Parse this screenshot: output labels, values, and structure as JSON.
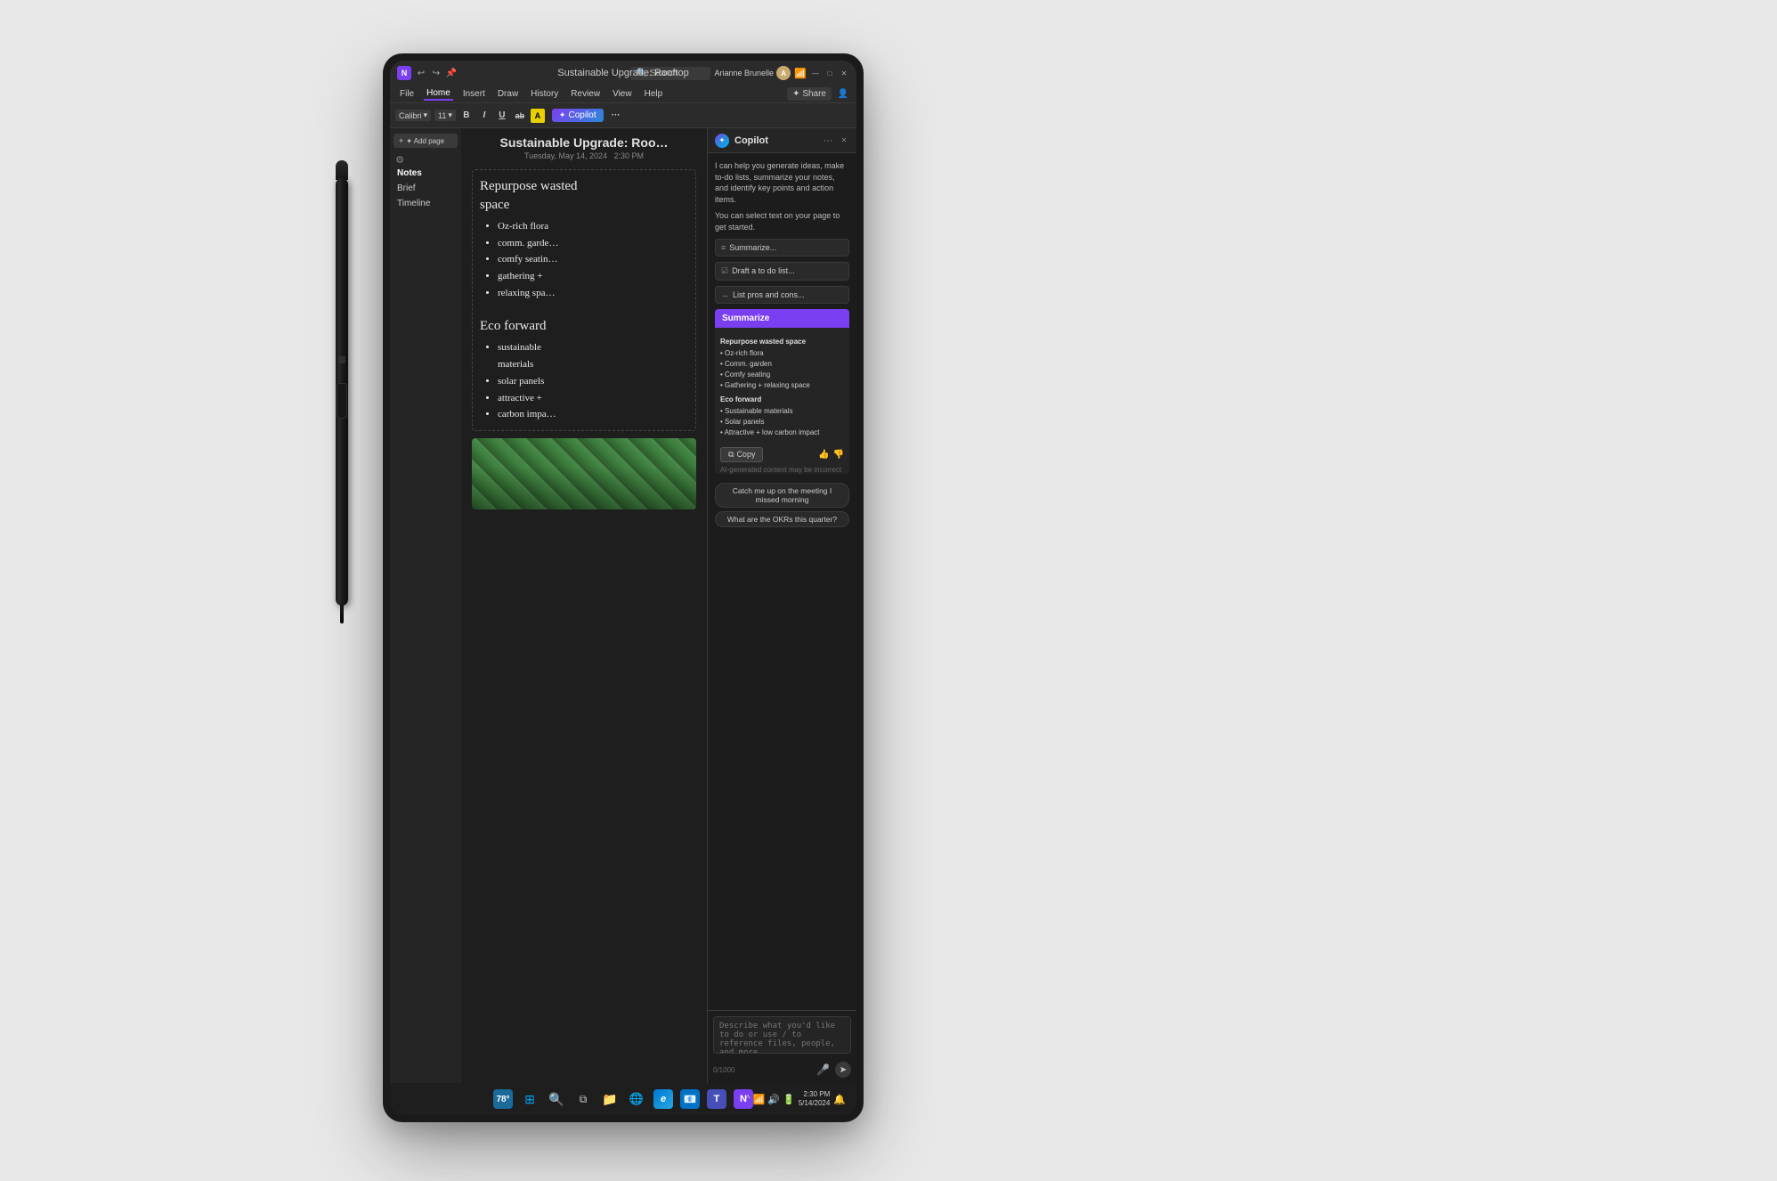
{
  "page": {
    "background_color": "#e8e8e8"
  },
  "titlebar": {
    "app_icon_label": "N",
    "undo_icon": "↩",
    "redo_icon": "↪",
    "pin_icon": "📌",
    "title": "Sustainable Upgrade: Rooftop",
    "search_placeholder": "Search",
    "user_name": "Arianne Brunelle",
    "wifi_icon": "📶",
    "minimize_icon": "—",
    "maximize_icon": "□",
    "close_icon": "✕"
  },
  "menubar": {
    "items": [
      {
        "label": "File",
        "active": false
      },
      {
        "label": "Home",
        "active": true
      },
      {
        "label": "Insert",
        "active": false
      },
      {
        "label": "Draw",
        "active": false
      },
      {
        "label": "History",
        "active": false
      },
      {
        "label": "Review",
        "active": false
      },
      {
        "label": "View",
        "active": false
      },
      {
        "label": "Help",
        "active": false
      }
    ],
    "share_label": "✦ Share",
    "profile_icon": "👤"
  },
  "ribbon": {
    "font_name": "Calibri",
    "font_size": "11",
    "bold": "B",
    "italic": "I",
    "underline": "U",
    "strikethrough": "ab",
    "highlight": "A",
    "copilot_label": "Copilot"
  },
  "sidebar": {
    "add_page_label": "✦ Add page",
    "sections": [
      {
        "label": "Notes",
        "active": true
      },
      {
        "label": "Brief"
      },
      {
        "label": "Timeline"
      }
    ]
  },
  "note": {
    "title": "Sustainable Upgrade: Roo…",
    "date": "Tuesday, May 14, 2024",
    "time": "2:30 PM",
    "content": {
      "heading1": "Repurpose wasted space",
      "bullets1": [
        "Oz-rich flora",
        "comm. garde…",
        "comfy seatin…",
        "gathering +",
        "relaxing spa…"
      ],
      "heading2": "Eco forward",
      "bullets2": [
        "sustainable materials",
        "solar panels",
        "attractive +",
        "carbon impa…"
      ]
    }
  },
  "copilot": {
    "title": "Copilot",
    "more_icon": "···",
    "close_icon": "✕",
    "intro_text": "I can help you generate ideas, make to-do lists, summarize your notes, and identify key points and action items.",
    "sub_text": "You can select text on your page to get started.",
    "suggestions": [
      {
        "icon": "≡",
        "label": "Summarize..."
      },
      {
        "icon": "☑",
        "label": "Draft a to do list..."
      },
      {
        "icon": "↔",
        "label": "List pros and cons..."
      }
    ],
    "summarize_button_label": "Summarize",
    "summary": {
      "heading1": "Repurpose wasted space",
      "bullets1": [
        "Oz-rich flora",
        "Comm. garden",
        "Comfy seating",
        "Gathering + relaxing space"
      ],
      "heading2": "Eco forward",
      "bullets2": [
        "Sustainable materials",
        "Solar panels",
        "Attractive + low carbon impact"
      ]
    },
    "copy_label": "Copy",
    "copy_icon": "⧉",
    "thumbs_up": "👍",
    "thumbs_down": "👎",
    "ai_disclaimer": "AI-generated content may be incorrect",
    "prompt_chips": [
      "Catch me up on the meeting I missed morning",
      "What are the OKRs this quarter?"
    ],
    "textarea_placeholder": "Describe what you'd like to do or use / to reference files, people, and more",
    "char_count": "0/1000",
    "mic_icon": "🎤",
    "send_icon": "➤"
  },
  "taskbar": {
    "weather": "78°",
    "windows_icon": "⊞",
    "search_icon": "🔍",
    "task_view_icon": "⧉",
    "explorer_icon": "📁",
    "browser_icon": "🌐",
    "edge_icon": "e",
    "outlook_icon": "📧",
    "teams_icon": "T",
    "onenote_icon": "N",
    "time": "2:30 PM",
    "date": "5/14/2024"
  }
}
